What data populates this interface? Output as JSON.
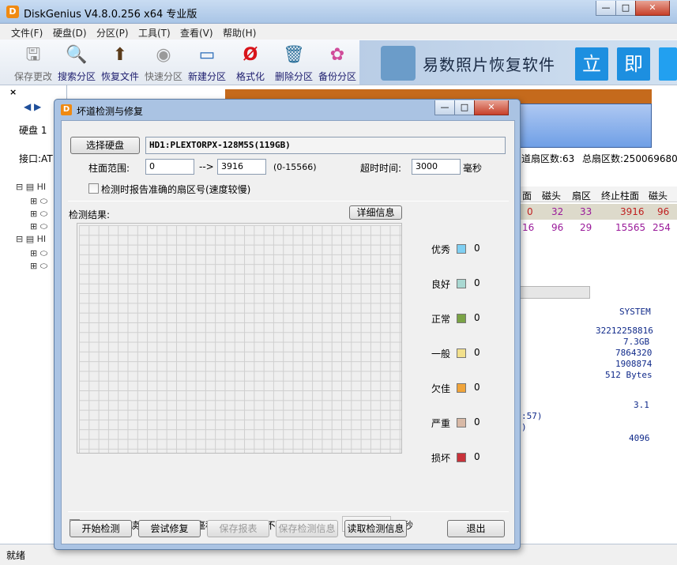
{
  "window": {
    "title": "DiskGenius V4.8.0.256 x64 专业版",
    "icon_letter": "D"
  },
  "menu": [
    "文件(F)",
    "硬盘(D)",
    "分区(P)",
    "工具(T)",
    "查看(V)",
    "帮助(H)"
  ],
  "toolbar": [
    {
      "label": "保存更改",
      "icon": "save-icon",
      "enabled": false
    },
    {
      "label": "搜索分区",
      "icon": "search-icon",
      "enabled": true
    },
    {
      "label": "恢复文件",
      "icon": "recover-icon",
      "enabled": true
    },
    {
      "label": "快速分区",
      "icon": "quick-partition-icon",
      "enabled": false
    },
    {
      "label": "新建分区",
      "icon": "new-partition-icon",
      "enabled": true
    },
    {
      "label": "格式化",
      "icon": "format-icon",
      "enabled": true
    },
    {
      "label": "删除分区",
      "icon": "delete-icon",
      "enabled": true
    },
    {
      "label": "备份分区",
      "icon": "backup-icon",
      "enabled": true
    }
  ],
  "ad": {
    "text": "易数照片恢复软件",
    "tile1": "立",
    "tile2": "即"
  },
  "left_panel": {
    "disk_label": "硬盘 1",
    "interface_label": "接口:AT"
  },
  "disk_info": {
    "tracks": "道扇区数:63",
    "total_sectors": "总扇区数:250069680"
  },
  "partition_table": {
    "headers": [
      "面",
      "磁头",
      "扇区",
      "终止柱面",
      "磁头"
    ],
    "rows": [
      [
        "0",
        "32",
        "33",
        "3916",
        "96"
      ],
      [
        "16",
        "96",
        "29",
        "15565",
        "254"
      ]
    ]
  },
  "details": {
    "fs": "SYSTEM",
    "values": [
      "32212258816",
      "7.3GB",
      "7864320",
      "1908874",
      "512 Bytes"
    ],
    "version": "3.1",
    "partial1": ":57)",
    "partial2": ")",
    "cluster": "4096"
  },
  "status": "就绪",
  "dialog": {
    "title": "坏道检测与修复",
    "select_disk_button": "选择硬盘",
    "disk_name": "HD1:PLEXTORPX-128M5S(119GB)",
    "cyl_label": "柱面范围:",
    "cyl_from": "0",
    "cyl_arrow": "-->",
    "cyl_to": "3916",
    "cyl_range": "(0-15566)",
    "timeout_label": "超时时间:",
    "timeout_value": "3000",
    "timeout_unit": "毫秒",
    "report_sector_label": "检测时报告准确的扇区号(速度较慢)",
    "result_label": "检测结果:",
    "details_button": "详细信息",
    "legend": [
      {
        "label": "优秀",
        "color": "#7fcff2",
        "count": "0"
      },
      {
        "label": "良好",
        "color": "#a9d8d2",
        "count": "0"
      },
      {
        "label": "正常",
        "color": "#7aa345",
        "count": "0"
      },
      {
        "label": "一般",
        "color": "#f2e08c",
        "count": "0"
      },
      {
        "label": "欠佳",
        "color": "#f0a43a",
        "count": "0"
      },
      {
        "label": "严重",
        "color": "#d8b9a6",
        "count": "0"
      },
      {
        "label": "损坏",
        "color": "#c8323a",
        "count": "0"
      }
    ],
    "repair_label": "修复时包括读写速度慢于此毫秒数的好磁道(不破坏数据):",
    "repair_value": "0",
    "repair_unit": "毫秒",
    "buttons": {
      "start": "开始检测",
      "try_repair": "尝试修复",
      "save_report": "保存报表",
      "save_info": "保存检测信息",
      "read_info": "读取检测信息",
      "exit": "退出"
    }
  }
}
